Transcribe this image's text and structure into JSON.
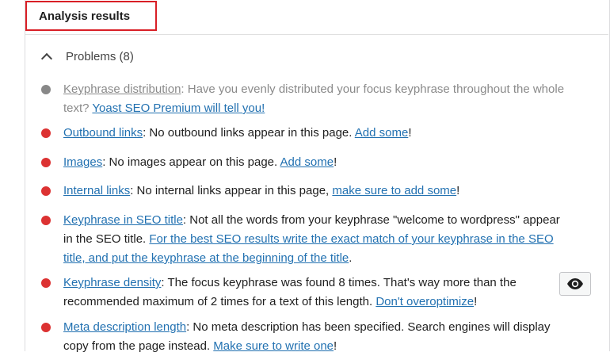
{
  "header": {
    "title": "Analysis results"
  },
  "problems": {
    "label": "Problems (8)"
  },
  "items": [
    {
      "status": "gray",
      "title": "Keyphrase distribution",
      "text": ": Have you evenly distributed your focus keyphrase throughout the whole text? ",
      "link": "Yoast SEO Premium will tell you!",
      "after": ""
    },
    {
      "status": "red",
      "title": "Outbound links",
      "text": ": No outbound links appear in this page. ",
      "link": "Add some",
      "after": "!"
    },
    {
      "status": "red",
      "title": "Images",
      "text": ": No images appear on this page. ",
      "link": "Add some",
      "after": "!"
    },
    {
      "status": "red",
      "title": "Internal links",
      "text": ": No internal links appear in this page, ",
      "link": "make sure to add some",
      "after": "!"
    },
    {
      "status": "red",
      "title": "Keyphrase in SEO title",
      "text": ": Not all the words from your keyphrase \"welcome to wordpress\" appear in the SEO title. ",
      "link": "For the best SEO results write the exact match of your keyphrase in the SEO title, and put the keyphrase at the beginning of the title",
      "after": "."
    },
    {
      "status": "red",
      "title": "Keyphrase density",
      "text": ": The focus keyphrase was found 8 times. That's way more than the recommended maximum of 2 times for a text of this length. ",
      "link": "Don't overoptimize",
      "after": "!"
    },
    {
      "status": "red",
      "title": "Meta description length",
      "text": ": No meta description has been specified. Search engines will display copy from the page instead. ",
      "link": "Make sure to write one",
      "after": "!"
    }
  ],
  "colors": {
    "red": "#dc3232",
    "gray": "#888888",
    "link": "#2271b1",
    "highlight": "#d91f26"
  },
  "icons": {
    "toggle": "chevron-up-icon",
    "eye": "eye-icon"
  }
}
